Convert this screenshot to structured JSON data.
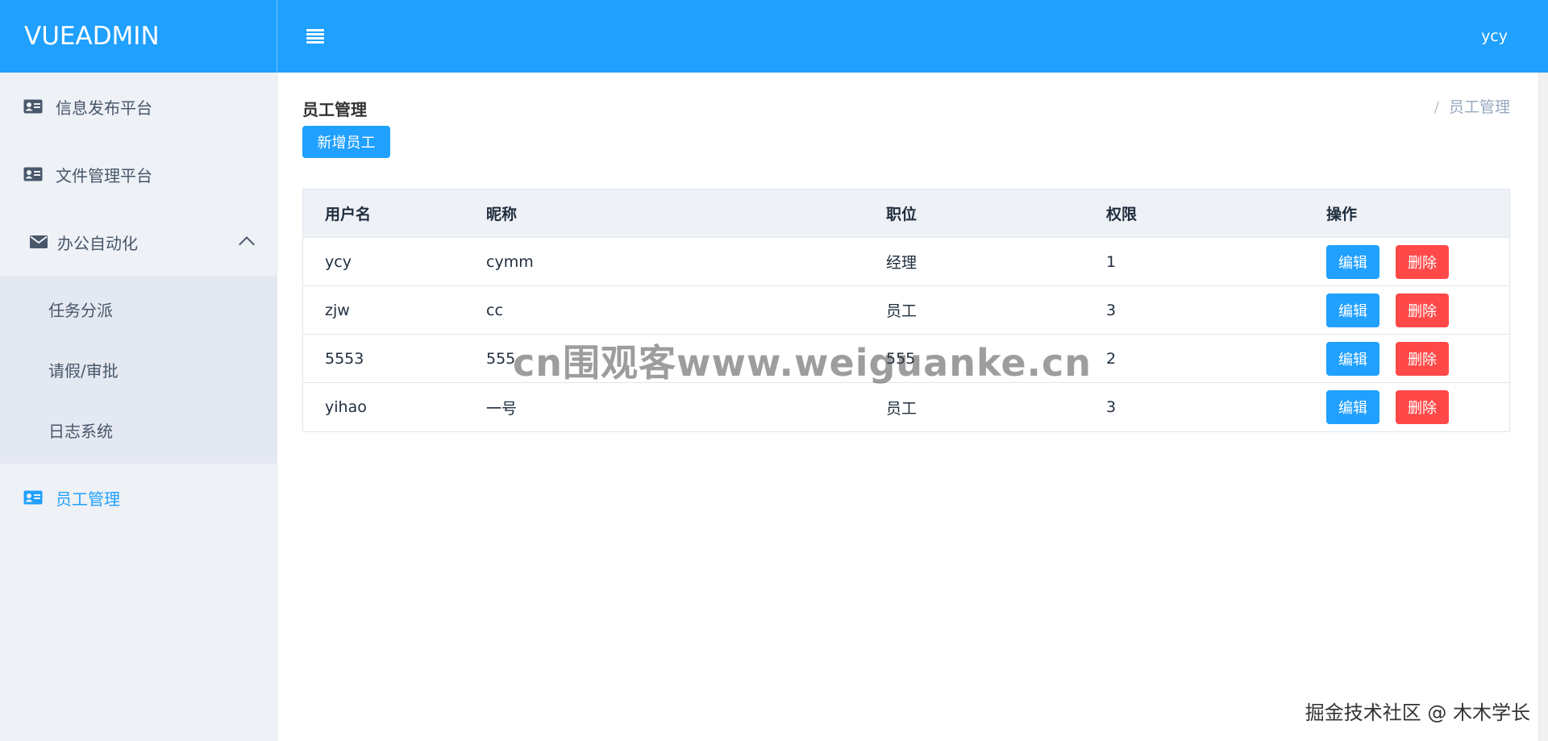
{
  "header": {
    "logo": "VUEADMIN",
    "user": "ycy"
  },
  "sidebar": {
    "items": [
      {
        "label": "信息发布平台",
        "icon": "id-card-icon"
      },
      {
        "label": "文件管理平台",
        "icon": "id-card-icon"
      },
      {
        "label": "办公自动化",
        "icon": "envelope-icon",
        "expanded": true
      },
      {
        "label": "员工管理",
        "icon": "id-card-icon",
        "active": true
      }
    ],
    "submenu": [
      "任务分派",
      "请假/审批",
      "日志系统"
    ]
  },
  "main": {
    "title": "员工管理",
    "breadcrumb_sep": "/",
    "breadcrumb": "员工管理",
    "add_button": "新增员工",
    "table": {
      "headers": [
        "用户名",
        "昵称",
        "职位",
        "权限",
        "操作"
      ],
      "rows": [
        {
          "username": "ycy",
          "nickname": "cymm",
          "position": "经理",
          "permission": "1"
        },
        {
          "username": "zjw",
          "nickname": "cc",
          "position": "员工",
          "permission": "3"
        },
        {
          "username": "5553",
          "nickname": "555",
          "position": "555",
          "permission": "2"
        },
        {
          "username": "yihao",
          "nickname": "一号",
          "position": "员工",
          "permission": "3"
        }
      ],
      "edit_label": "编辑",
      "delete_label": "删除"
    }
  },
  "overlays": {
    "watermark": "cn围观客www.weiguanke.cn",
    "footer": "掘金技术社区 @ 木木学长"
  },
  "colors": {
    "primary": "#20a0ff",
    "danger": "#ff4949",
    "sidebar_bg": "#eef1f6"
  }
}
